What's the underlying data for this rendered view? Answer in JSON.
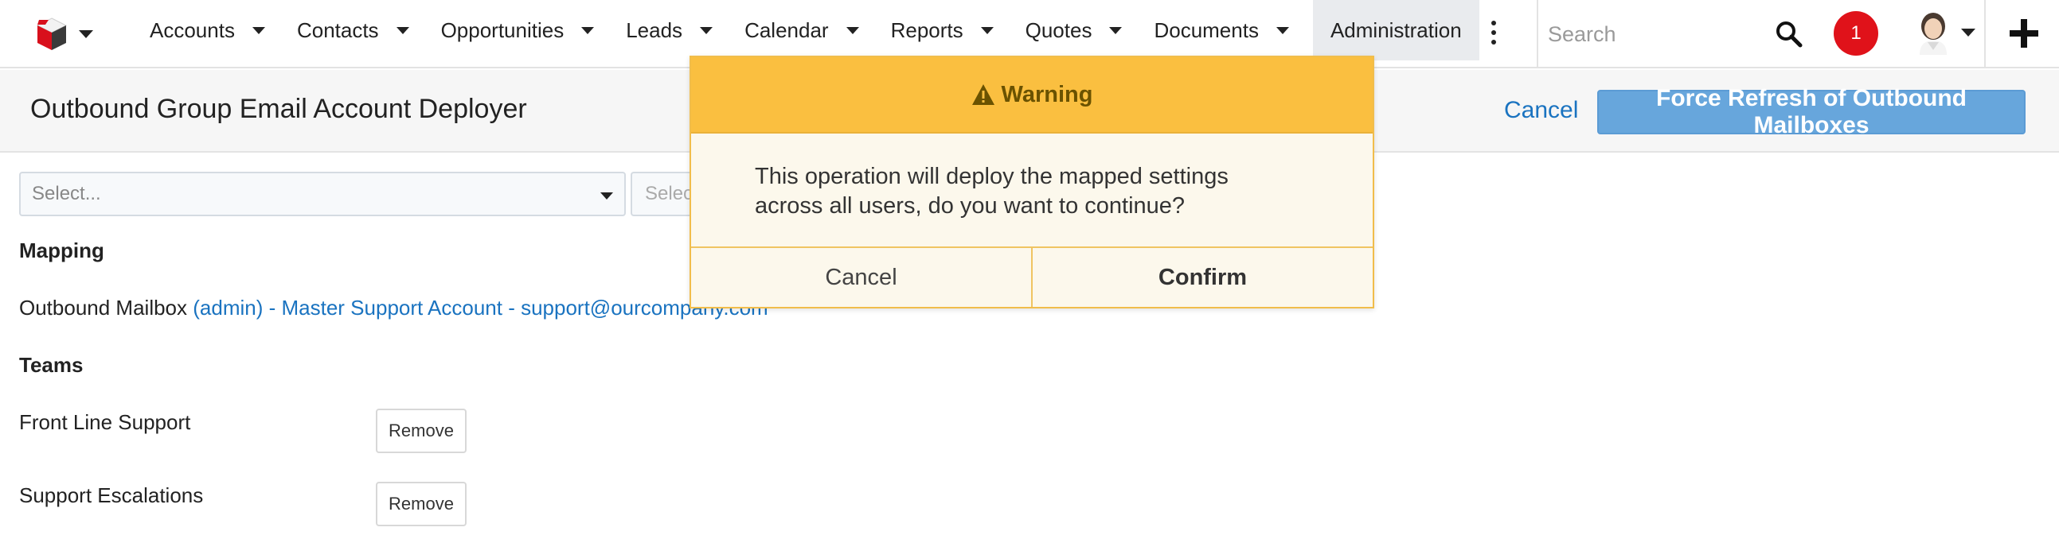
{
  "nav": {
    "items": [
      {
        "label": "Accounts"
      },
      {
        "label": "Contacts"
      },
      {
        "label": "Opportunities"
      },
      {
        "label": "Leads"
      },
      {
        "label": "Calendar"
      },
      {
        "label": "Reports"
      },
      {
        "label": "Quotes"
      },
      {
        "label": "Documents"
      }
    ],
    "active_label": "Administration",
    "search_placeholder": "Search",
    "notification_count": "1"
  },
  "header": {
    "title": "Outbound Group Email Account Deployer",
    "cancel_label": "Cancel",
    "primary_label": "Force Refresh of Outbound Mailboxes"
  },
  "form": {
    "select1_placeholder": "Select...",
    "select2_placeholder": "Select..."
  },
  "mapping": {
    "heading": "Mapping",
    "prefix": "Outbound Mailbox",
    "value": "(admin) - Master Support Account - support@ourcompany.com"
  },
  "teams": {
    "heading": "Teams",
    "items": [
      {
        "name": "Front Line Support",
        "action": "Remove"
      },
      {
        "name": "Support Escalations",
        "action": "Remove"
      }
    ]
  },
  "modal": {
    "title": "Warning",
    "message_line1": "This operation will deploy the mapped settings",
    "message_line2": "across all users, do you want to continue?",
    "cancel_label": "Cancel",
    "confirm_label": "Confirm"
  },
  "colors": {
    "accent_link": "#1a73c0",
    "primary_button": "#67a6dc",
    "warning_header": "#fabf40",
    "notification_badge": "#e0121a"
  },
  "icons": [
    "logo-cube-icon",
    "search-icon",
    "more-vertical-icon",
    "plus-icon",
    "warning-icon",
    "chevron-down-icon"
  ]
}
